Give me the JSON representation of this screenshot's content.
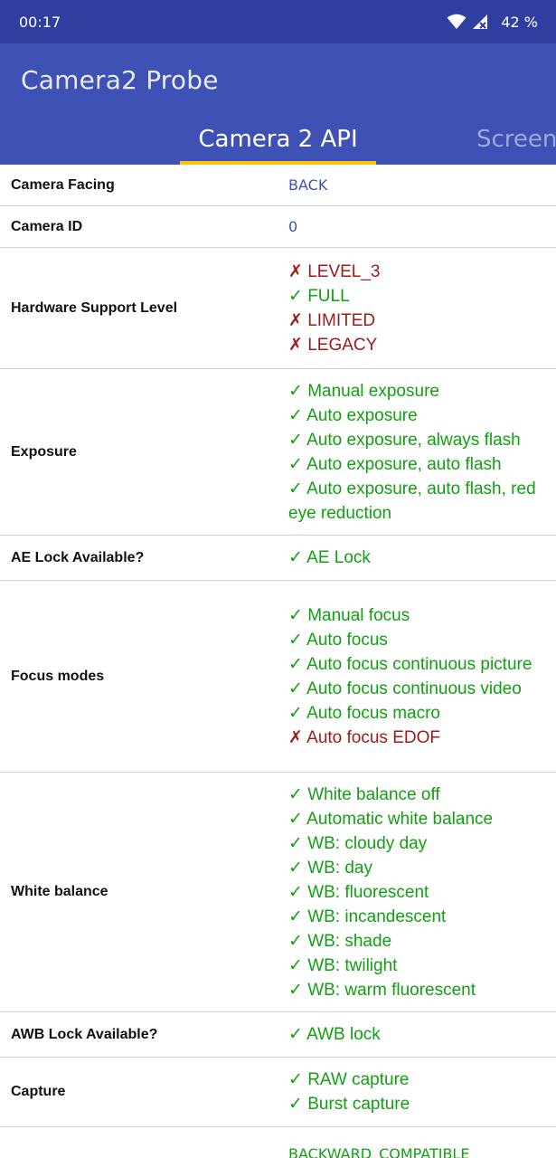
{
  "status_bar": {
    "time": "00:17",
    "battery": "42 %"
  },
  "app_bar": {
    "title": "Camera2 Probe"
  },
  "tabs": [
    {
      "label": "Camera 2 API"
    },
    {
      "label": "Screen"
    }
  ],
  "colors": {
    "ok": "#11a011",
    "no": "#9e1a1a",
    "accent": "#ffc107",
    "primary": "#3f51b5"
  },
  "rows": [
    {
      "label": "Camera Facing",
      "value": "BACK"
    },
    {
      "label": "Camera ID",
      "value": "0"
    },
    {
      "label": "Hardware Support Level",
      "items": [
        {
          "mark": "✗",
          "text": "LEVEL_3"
        },
        {
          "mark": "✓",
          "text": "FULL"
        },
        {
          "mark": "✗",
          "text": "LIMITED"
        },
        {
          "mark": "✗",
          "text": "LEGACY"
        }
      ]
    },
    {
      "label": "Exposure",
      "items": [
        {
          "mark": "✓",
          "text": "Manual exposure"
        },
        {
          "mark": "✓",
          "text": "Auto exposure"
        },
        {
          "mark": "✓",
          "text": "Auto exposure, always flash"
        },
        {
          "mark": "✓",
          "text": "Auto exposure, auto flash"
        },
        {
          "mark": "✓",
          "text": "Auto exposure, auto flash, red eye reduction"
        }
      ]
    },
    {
      "label": "AE Lock Available?",
      "items": [
        {
          "mark": "✓",
          "text": "AE Lock"
        }
      ]
    },
    {
      "label": "Focus modes",
      "items": [
        {
          "mark": "✓",
          "text": "Manual focus"
        },
        {
          "mark": "✓",
          "text": "Auto focus"
        },
        {
          "mark": "✓",
          "text": "Auto focus continuous picture"
        },
        {
          "mark": "✓",
          "text": "Auto focus continuous video"
        },
        {
          "mark": "✓",
          "text": "Auto focus macro"
        },
        {
          "mark": "✗",
          "text": "Auto focus EDOF"
        }
      ]
    },
    {
      "label": "White balance",
      "items": [
        {
          "mark": "✓",
          "text": "White balance off"
        },
        {
          "mark": "✓",
          "text": "Automatic white balance"
        },
        {
          "mark": "✓",
          "text": "WB: cloudy day"
        },
        {
          "mark": "✓",
          "text": "WB: day"
        },
        {
          "mark": "✓",
          "text": "WB: fluorescent"
        },
        {
          "mark": "✓",
          "text": "WB: incandescent"
        },
        {
          "mark": "✓",
          "text": "WB: shade"
        },
        {
          "mark": "✓",
          "text": "WB: twilight"
        },
        {
          "mark": "✓",
          "text": "WB: warm fluorescent"
        }
      ]
    },
    {
      "label": "AWB Lock Available?",
      "items": [
        {
          "mark": "✓",
          "text": "AWB lock"
        }
      ]
    },
    {
      "label": "Capture",
      "items": [
        {
          "mark": "✓",
          "text": "RAW capture"
        },
        {
          "mark": "✓",
          "text": "Burst capture"
        }
      ]
    },
    {
      "label": "",
      "value_ok": "BACKWARD_COMPATIBLE"
    }
  ]
}
